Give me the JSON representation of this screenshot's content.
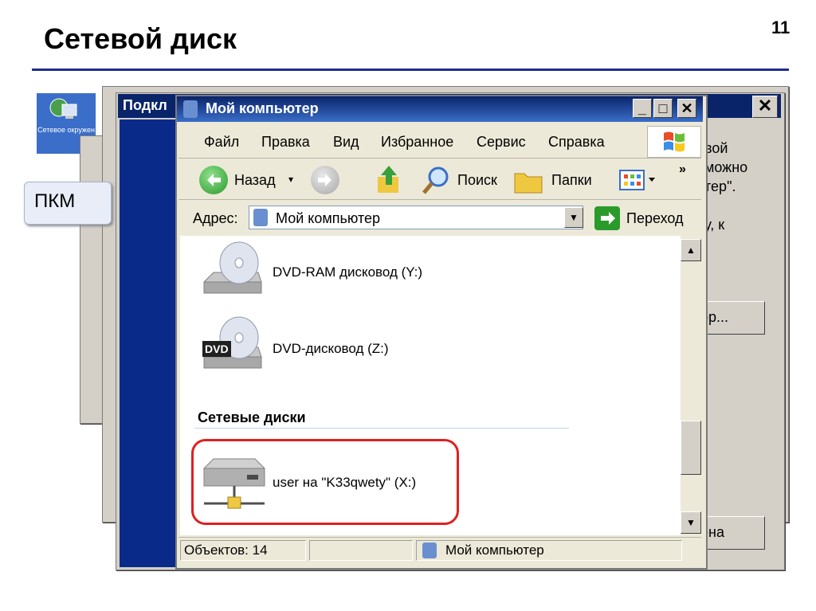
{
  "slide": {
    "title": "Сетевой диск",
    "number": "11"
  },
  "desktop_icon": {
    "label": "Сетевое окружен"
  },
  "callout": {
    "text": "ПКМ"
  },
  "background_window": {
    "title": "Подкл",
    "close_label": "✕",
    "text_lines": [
      "вой",
      "можно",
      "тер\".",
      "у, к"
    ],
    "button1": "ор...",
    "button2": "ена"
  },
  "window": {
    "title": "Мой компьютер",
    "minimize": "_",
    "maximize": "□",
    "close": "✕",
    "menu": [
      "Файл",
      "Правка",
      "Вид",
      "Избранное",
      "Сервис",
      "Справка"
    ],
    "toolbar": {
      "back": "Назад",
      "search": "Поиск",
      "folders": "Папки",
      "more": "»"
    },
    "address": {
      "label": "Адрес:",
      "value": "Мой компьютер",
      "go": "Переход"
    },
    "items": [
      {
        "label": "DVD-RAM дисковод (Y:)",
        "icon": "dvd-ram-drive-icon"
      },
      {
        "label": "DVD-дисковод (Z:)",
        "icon": "dvd-drive-icon",
        "badge": "DVD"
      }
    ],
    "section": "Сетевые диски",
    "network_item": {
      "label": "user на \"K33qwety\" (X:)",
      "icon": "network-drive-icon"
    },
    "status": {
      "objects": "Объектов: 14",
      "location": "Мой компьютер"
    }
  },
  "colors": {
    "title_line": "#1f2d8a",
    "titlebar": "#0a246a",
    "highlight": "#e02020"
  }
}
